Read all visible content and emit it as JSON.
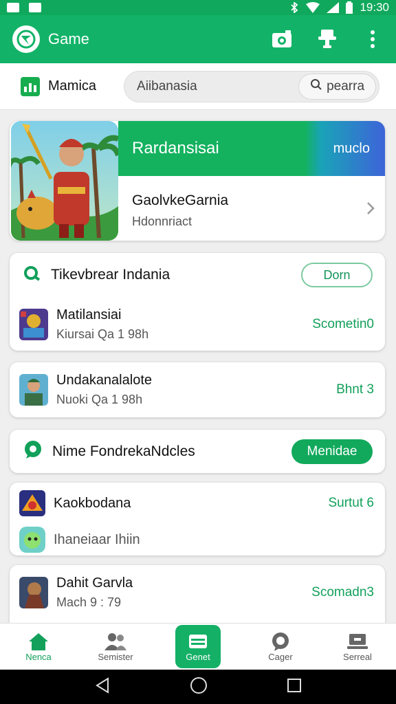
{
  "status_bar": {
    "time": "19:30"
  },
  "app_bar": {
    "title": "Game",
    "icons": [
      "logo-icon",
      "camera-icon",
      "trophy-icon",
      "more-vert-icon"
    ]
  },
  "search_row": {
    "region_label": "Mamica",
    "search_value": "Aiibanasia",
    "search_button": "pearra"
  },
  "feature": {
    "banner_title": "Rardansisai",
    "banner_tag": "muclo",
    "name": "GaolvkeGarnia",
    "subtitle": "Hdonnriact"
  },
  "section1": {
    "title": "Tikevbrear Indania",
    "button": "Dorn"
  },
  "list1": [
    {
      "name": "Matilansiai",
      "meta": "Kiursai Qa 1 98h",
      "value": "Scometin0"
    }
  ],
  "list2": [
    {
      "name": "Undakanalalote",
      "meta": "Nuoki Qa 1 98h",
      "value": "Bhnt 3"
    }
  ],
  "section2": {
    "title": "Nime FondrekaNdcles",
    "button": "Menidae"
  },
  "list3": [
    {
      "name": "Kaokbodana",
      "meta": "",
      "value": "Surtut 6"
    },
    {
      "name": "",
      "meta": "Ihaneiaar Ihiin",
      "value": ""
    }
  ],
  "list4": [
    {
      "name": "Dahit Garvla",
      "meta": "Mach 9 : 79",
      "value": "Scomadn3"
    }
  ],
  "bottom_nav": [
    {
      "label": "Nenca",
      "icon": "home-icon"
    },
    {
      "label": "Semister",
      "icon": "people-icon"
    },
    {
      "label": "Genet",
      "icon": "cards-icon"
    },
    {
      "label": "Cager",
      "icon": "chat-icon"
    },
    {
      "label": "Serreal",
      "icon": "laptop-icon"
    }
  ],
  "colors": {
    "primary": "#12b368",
    "accent_text": "#12a05a",
    "banner_blue": "#3d64d8"
  }
}
